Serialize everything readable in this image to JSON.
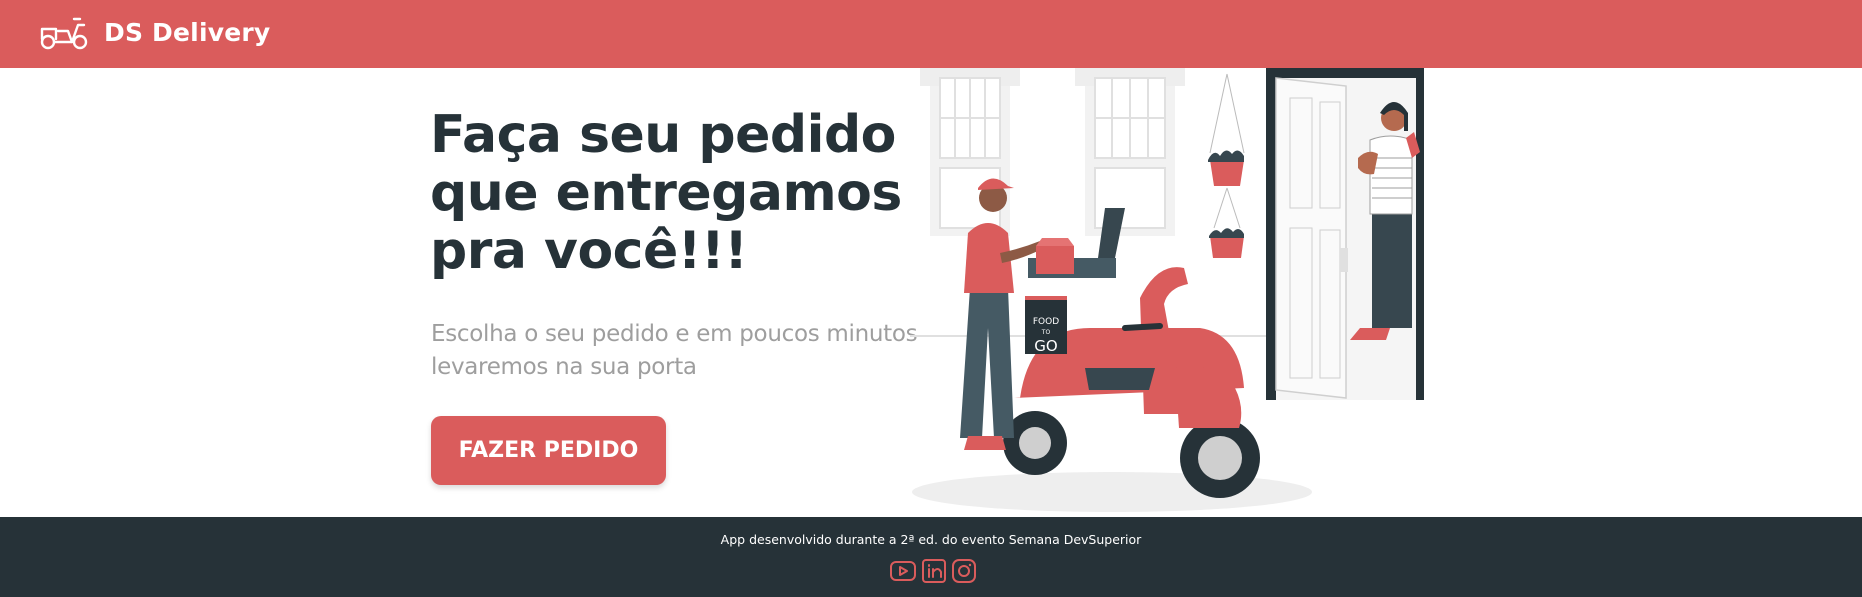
{
  "navbar": {
    "brand": "DS Delivery",
    "logo_icon": "scooter-icon",
    "background": "#DA5C5C"
  },
  "hero": {
    "title": "Faça seu pedido que entregamos pra você!!!",
    "subtitle": "Escolha o seu pedido e em poucos minutos levaremos na sua porta",
    "cta_label": "FAZER PEDIDO",
    "illustration_box_text": [
      "FOOD",
      "TO",
      "GO"
    ]
  },
  "footer": {
    "text": "App desenvolvido durante a 2ª ed. do evento Semana DevSuperior",
    "social_icons": [
      "youtube-icon",
      "linkedin-icon",
      "instagram-icon"
    ],
    "background": "#263238"
  },
  "colors": {
    "accent": "#DA5C5C",
    "dark": "#263238",
    "muted": "#9E9E9E"
  }
}
